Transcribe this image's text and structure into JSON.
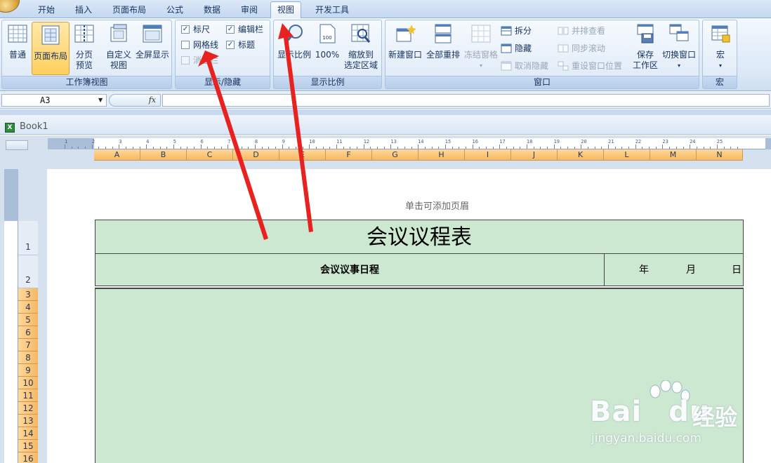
{
  "tabs": [
    "开始",
    "插入",
    "页面布局",
    "公式",
    "数据",
    "审阅",
    "视图",
    "开发工具"
  ],
  "active_tab": "视图",
  "groups": {
    "workbook_views": {
      "caption": "工作簿视图",
      "normal": "普通",
      "page_layout": "页面布局",
      "page_break_1": "分页",
      "page_break_2": "预览",
      "custom_1": "自定义",
      "custom_2": "视图",
      "fullscreen": "全屏显示"
    },
    "show_hide": {
      "caption": "显示/隐藏",
      "ruler": "标尺",
      "gridlines": "网格线",
      "message_bar": "消息栏",
      "formula_bar": "编辑栏",
      "headings": "标题",
      "ruler_checked": "✓",
      "formula_bar_checked": "✓",
      "headings_checked": "✓"
    },
    "zoom": {
      "caption": "显示比例",
      "zoom": "显示比例",
      "hundred": "100%",
      "hundred_icon_text": "100",
      "zoom_sel_1": "缩放到",
      "zoom_sel_2": "选定区域"
    },
    "window": {
      "caption": "窗口",
      "new_window": "新建窗口",
      "arrange_all": "全部重排",
      "freeze_panes": "冻结窗格",
      "split": "拆分",
      "hide": "隐藏",
      "unhide": "取消隐藏",
      "side_by_side": "并排查看",
      "sync_scroll": "同步滚动",
      "reset_pos": "重设窗口位置",
      "save_ws_1": "保存",
      "save_ws_2": "工作区",
      "switch_windows": "切换窗口"
    },
    "macros": {
      "caption": "宏",
      "macros": "宏"
    }
  },
  "formula_bar": {
    "name_box": "A3",
    "fx": "fx",
    "formula": ""
  },
  "workbook_title": "Book1",
  "ruler_numbers": [
    "1",
    "2",
    "3",
    "4",
    "5",
    "6",
    "7",
    "8",
    "9",
    "10",
    "11",
    "12",
    "13",
    "14",
    "15",
    "16",
    "17",
    "18",
    "19",
    "20",
    "21",
    "22",
    "23",
    "24",
    "25"
  ],
  "columns": [
    "A",
    "B",
    "C",
    "D",
    "E",
    "F",
    "G",
    "H",
    "I",
    "J",
    "K",
    "L",
    "M",
    "N"
  ],
  "rows": [
    "1",
    "2",
    "3",
    "4",
    "5",
    "6",
    "7",
    "8",
    "9",
    "10",
    "11",
    "12",
    "13",
    "14",
    "15",
    "16"
  ],
  "page": {
    "header_hint": "单击可添加页眉",
    "title": "会议议程表",
    "agenda": "会议议事日程",
    "date_year": "年",
    "date_month": "月",
    "date_day": "日"
  },
  "watermark": {
    "brand": "Bai",
    "brand_du": "du",
    "brand_cn": "经验",
    "url": "jingyan.baidu.com"
  },
  "colors": {
    "accent_active": "#ffcf5e",
    "column_header": "#f6b864",
    "sheet_fill": "#cce8d0",
    "arrow": "#e8231f"
  }
}
